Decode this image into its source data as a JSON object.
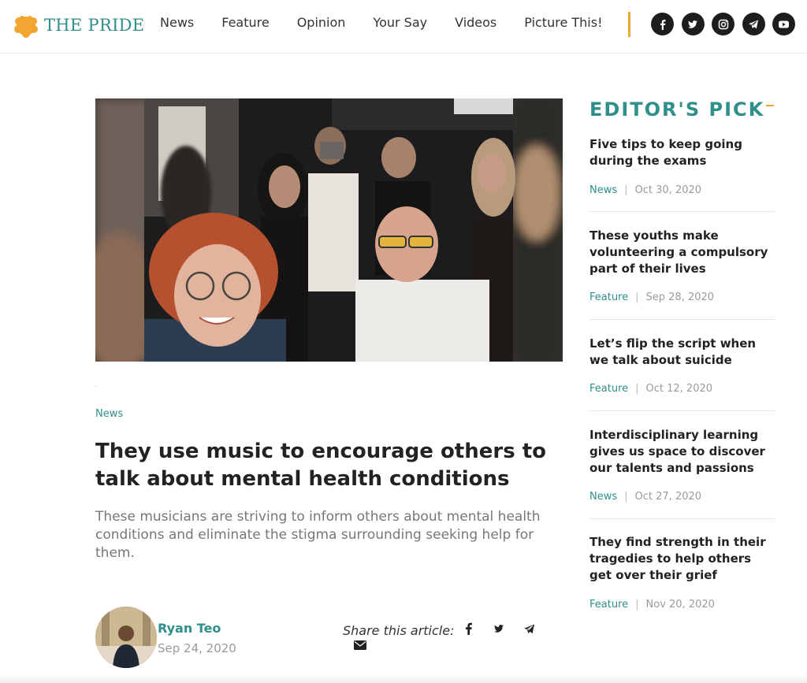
{
  "site": {
    "logo_text": "THE PRIDE",
    "brand_color": "#2f8f8a",
    "accent_color": "#e8a93b"
  },
  "nav": {
    "items": [
      {
        "label": "News"
      },
      {
        "label": "Feature"
      },
      {
        "label": "Opinion"
      },
      {
        "label": "Your Say"
      },
      {
        "label": "Videos"
      },
      {
        "label": "Picture This!"
      }
    ]
  },
  "socials": [
    "facebook-icon",
    "twitter-icon",
    "instagram-icon",
    "telegram-icon",
    "youtube-icon"
  ],
  "article": {
    "category": "News",
    "title": "They use music to encourage others to talk about mental health conditions",
    "summary": "These musicians are striving to inform others about mental health conditions and eliminate the stigma surrounding seeking help for them.",
    "author": "Ryan Teo",
    "date": "Sep 24, 2020",
    "share_label": "Share this article:"
  },
  "editors_pick": {
    "title": "EDITOR'S PICK",
    "items": [
      {
        "headline": "Five tips to keep going during the exams",
        "category": "News",
        "date": "Oct 30, 2020"
      },
      {
        "headline": "These youths make volunteering a compulsory part of their lives",
        "category": "Feature",
        "date": "Sep 28, 2020"
      },
      {
        "headline": "Let’s flip the script when we talk about suicide",
        "category": "Feature",
        "date": "Oct 12, 2020"
      },
      {
        "headline": "Interdisciplinary learning gives us space to discover our talents and passions",
        "category": "News",
        "date": "Oct 27, 2020"
      },
      {
        "headline": "They find strength in their tragedies to help others get over their grief",
        "category": "Feature",
        "date": "Nov 20, 2020"
      }
    ]
  }
}
